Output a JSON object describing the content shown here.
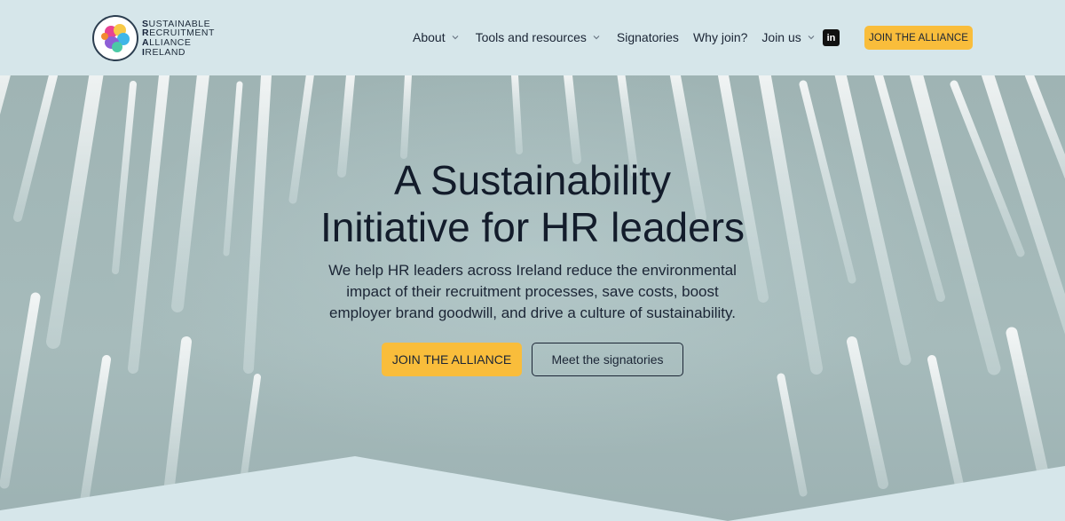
{
  "header": {
    "logo": {
      "lines": [
        {
          "initial": "S",
          "rest": "USTAINABLE"
        },
        {
          "initial": "R",
          "rest": "ECRUITMENT"
        },
        {
          "initial": "A",
          "rest": "LLIANCE"
        },
        {
          "initial": "I",
          "rest": "RELAND"
        }
      ]
    },
    "nav": [
      {
        "label": "About",
        "has_dropdown": true
      },
      {
        "label": "Tools and resources",
        "has_dropdown": true
      },
      {
        "label": "Signatories",
        "has_dropdown": false
      },
      {
        "label": "Why join?",
        "has_dropdown": false
      },
      {
        "label": "Join us",
        "has_dropdown": true
      }
    ],
    "linkedin_icon": "linkedin-icon",
    "linkedin_glyph": "in",
    "cta_label": "JOIN THE ALLIANCE"
  },
  "hero": {
    "title_line1": "A Sustainability",
    "title_line2": "Initiative for HR leaders",
    "subtitle_line1": "We help HR leaders across Ireland reduce the environmental",
    "subtitle_line2": "impact of their recruitment processes, save costs, boost",
    "subtitle_line3": "employer brand goodwill, and drive a culture of sustainability.",
    "primary_button": "JOIN THE ALLIANCE",
    "secondary_button": "Meet the signatories"
  },
  "colors": {
    "background": "#d6e6ea",
    "accent": "#f9bd3b",
    "text": "#1b2535"
  }
}
